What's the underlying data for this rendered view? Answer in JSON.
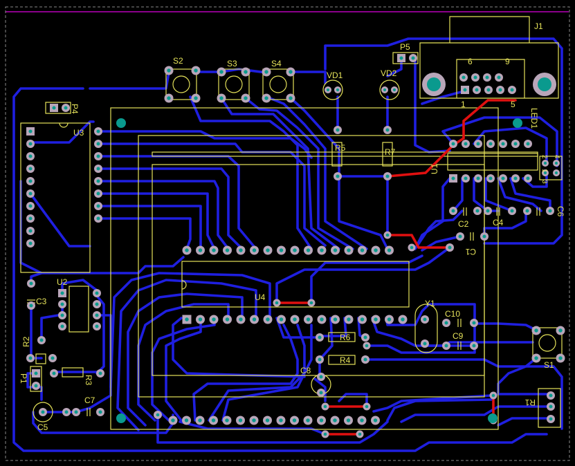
{
  "colors": {
    "background": "#000000",
    "top_layer_trace": "#e01010",
    "bottom_layer_trace": "#1f1fe0",
    "silkscreen": "#e6e35a",
    "pad": "#b9a6b9",
    "via_hole": "#0a9a8e",
    "board_outline": "#b900b9"
  },
  "labels": {
    "j1": "J1",
    "j1_pin6": "6",
    "j1_pin9": "9",
    "j1_pin1": "1",
    "j1_pin5": "5",
    "s2": "S2",
    "s3": "S3",
    "s4": "S4",
    "s1": "S1",
    "vd1": "VD1",
    "vd2": "VD2",
    "p5": "P5",
    "p4": "P4",
    "p1": "P1",
    "u3": "U3",
    "u2": "U2",
    "u4": "U4",
    "u1": "U1",
    "led1": "LED1",
    "r5": "R5",
    "r7": "R7",
    "r6": "R6",
    "r4": "R4",
    "r3": "R3",
    "r2": "R2",
    "r1": "R1",
    "c1": "C1",
    "c2": "C2",
    "c3": "C3",
    "c4": "C4",
    "c5": "C5",
    "c6": "C6",
    "c7": "C7",
    "c8": "C8",
    "c9": "C9",
    "c10": "C10",
    "y1": "Y1",
    "hdr_2": "2",
    "hdr_4": "4",
    "hdr_1": "1",
    "hdr_3": "3"
  }
}
